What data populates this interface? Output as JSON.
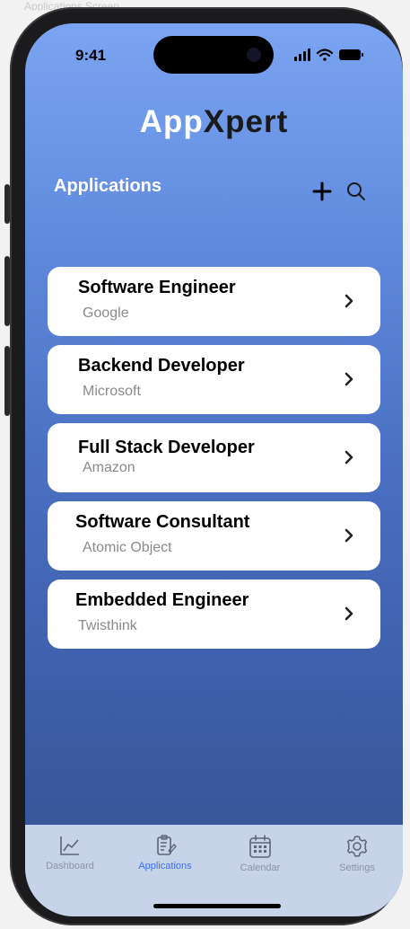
{
  "caption": "Applications Screen",
  "status_bar": {
    "time": "9:41",
    "icons": [
      "signal-icon",
      "wifi-icon",
      "battery-icon"
    ]
  },
  "brand": {
    "part1": "App",
    "part2": "Xpert"
  },
  "header": {
    "title": "Applications",
    "add_icon": "plus-icon",
    "search_icon": "search-icon"
  },
  "applications": [
    {
      "title": "Software Engineer",
      "company": "Google"
    },
    {
      "title": "Backend Developer",
      "company": "Microsoft"
    },
    {
      "title": "Full Stack Developer",
      "company": "Amazon"
    },
    {
      "title": "Software Consultant",
      "company": "Atomic Object"
    },
    {
      "title": "Embedded Engineer",
      "company": "Twisthink"
    }
  ],
  "tabbar": {
    "tabs": [
      {
        "label": "Dashboard",
        "icon": "chart-icon",
        "active": false
      },
      {
        "label": "Applications",
        "icon": "clipboard-icon",
        "active": true
      },
      {
        "label": "Calendar",
        "icon": "calendar-icon",
        "active": false
      },
      {
        "label": "Settings",
        "icon": "gear-icon",
        "active": false
      }
    ]
  },
  "colors": {
    "gradient_top": "#7ba5f2",
    "gradient_bottom": "#34508e",
    "active_tab": "#3b6ef0",
    "inactive_tab": "#8b93a3",
    "tabbar_bg": "#c7d3e8"
  }
}
